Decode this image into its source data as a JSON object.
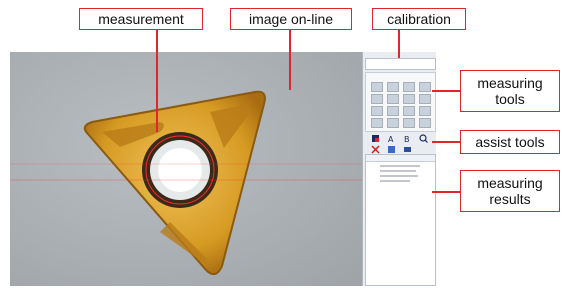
{
  "callouts": {
    "measurement": "measurement",
    "image_online": "image on-line",
    "calibration": "calibration",
    "measuring_tools": "measuring\ntools",
    "assist_tools": "assist tools",
    "measuring_results": "measuring\nresults"
  },
  "colors": {
    "callout_border": "#e0262b",
    "insert_gold": "#d9a22a",
    "measure_overlay": "#ff2a2a"
  },
  "icons": {
    "assist_tools": [
      "color-picker-icon",
      "text-icon",
      "bold-icon",
      "magnifier-icon",
      "delete-x-icon",
      "edit-icon",
      "image-icon"
    ]
  }
}
